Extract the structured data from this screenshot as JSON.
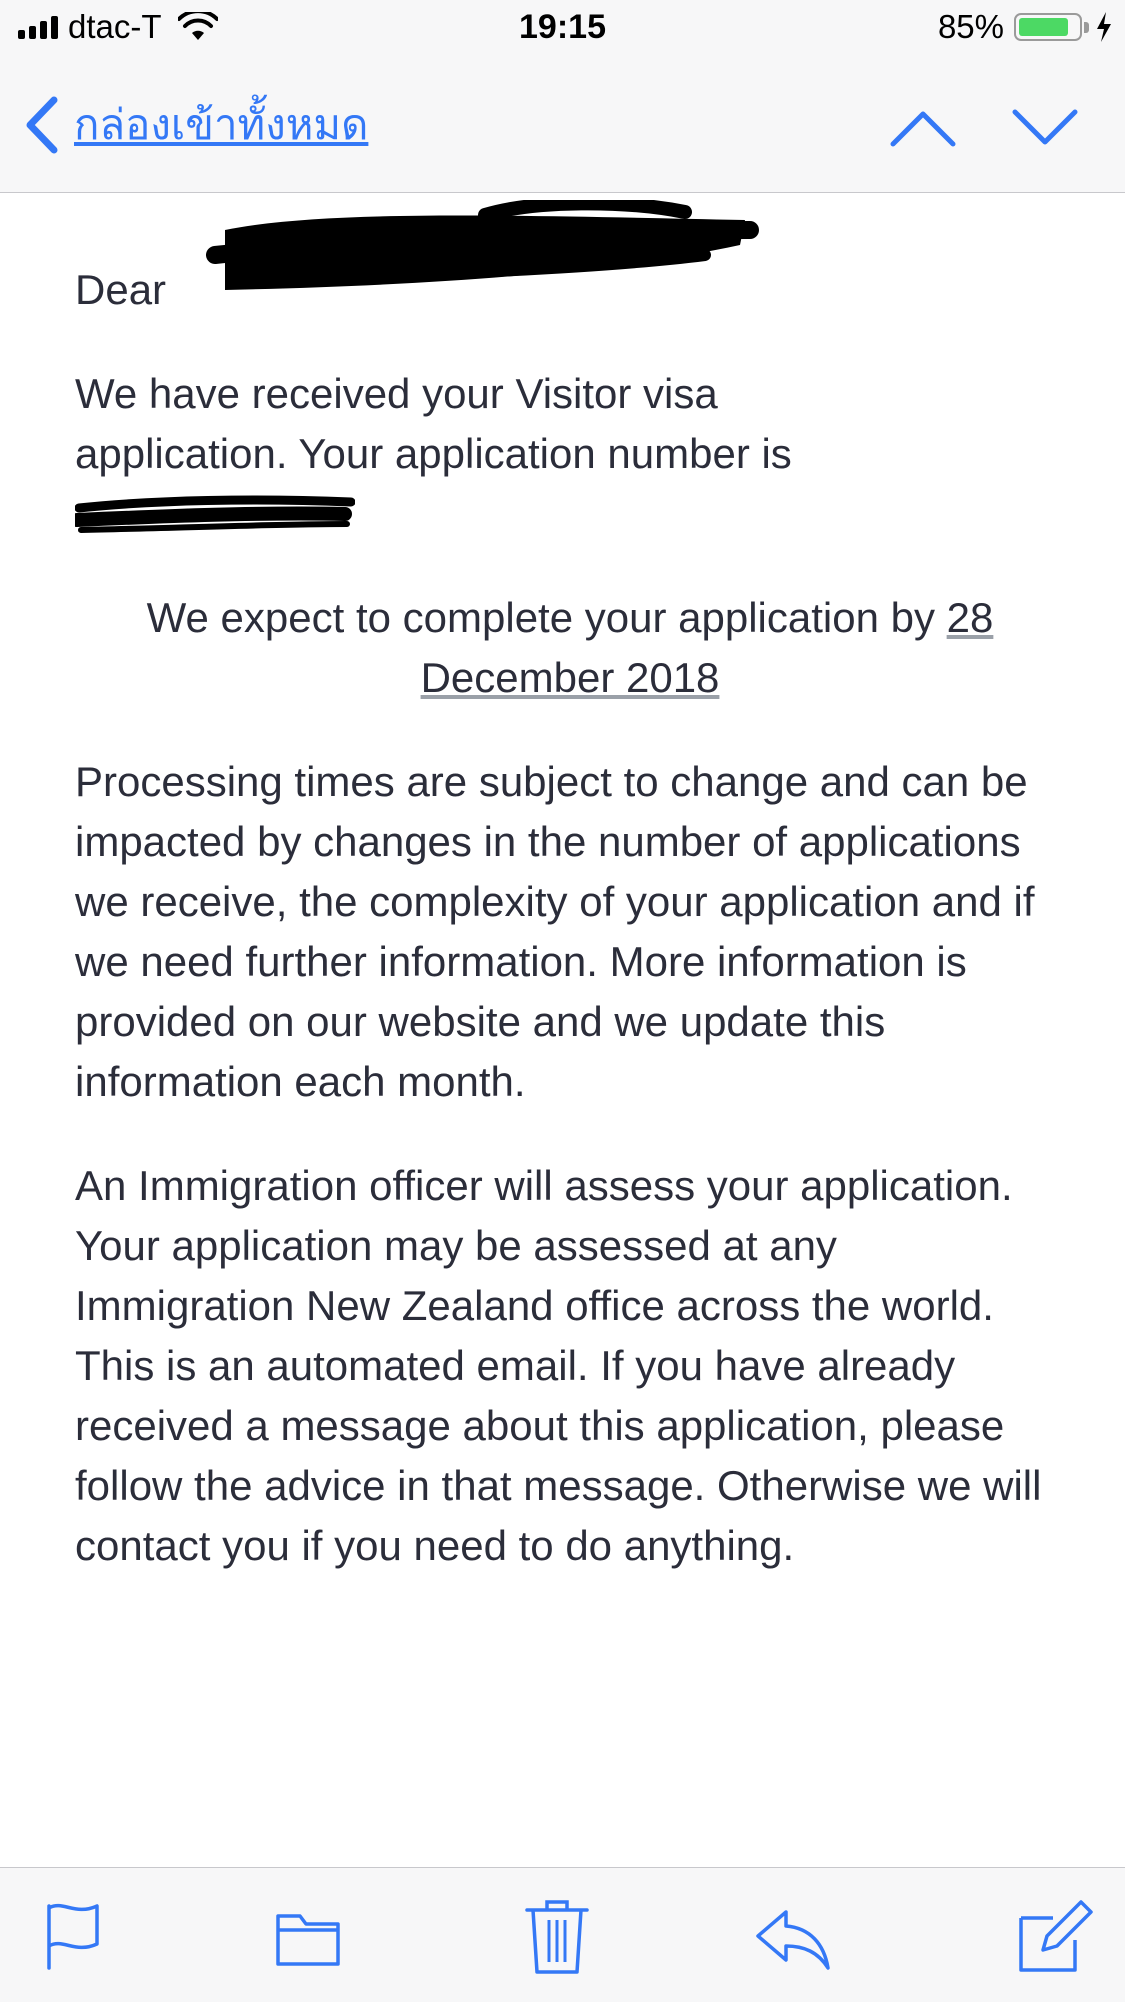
{
  "status_bar": {
    "carrier": "dtac-T",
    "time": "19:15",
    "battery_percent": "85%",
    "battery_level": 0.85,
    "icons": [
      "signal-icon",
      "wifi-icon",
      "battery-icon",
      "charging-bolt-icon"
    ]
  },
  "nav": {
    "back_label": "กล่องเข้าทั้งหมด",
    "icons": [
      "back-chevron-icon",
      "chevron-up-icon",
      "chevron-down-icon"
    ]
  },
  "email": {
    "greeting": "Dear",
    "para_received_line1": "We have received your Visitor visa",
    "para_received_line2": "application. Your application number is",
    "para_expect_prefix": "We expect to complete your application by ",
    "para_expect_date_part1": "28",
    "para_expect_date_part2": "December 2018",
    "para_processing": "Processing times are subject to change and can be impacted by changes in the number of applications we receive, the complexity of your application and if we need further information. More information is provided on our website and we update this information each month.",
    "para_assess": "An Immigration officer will assess your application. Your application may be assessed at any Immigration New Zealand office across the world.",
    "para_automated": "This is an automated email. If you have already received a message about this application, please follow the advice in that message. Otherwise we will contact you if you need to do anything."
  },
  "toolbar": {
    "icons": [
      "flag-icon",
      "folder-icon",
      "trash-icon",
      "reply-icon",
      "compose-icon"
    ]
  },
  "colors": {
    "accent": "#3478f6",
    "text": "#2b2d3a",
    "bar_background": "#f7f7f8",
    "battery_green": "#4cd964"
  }
}
